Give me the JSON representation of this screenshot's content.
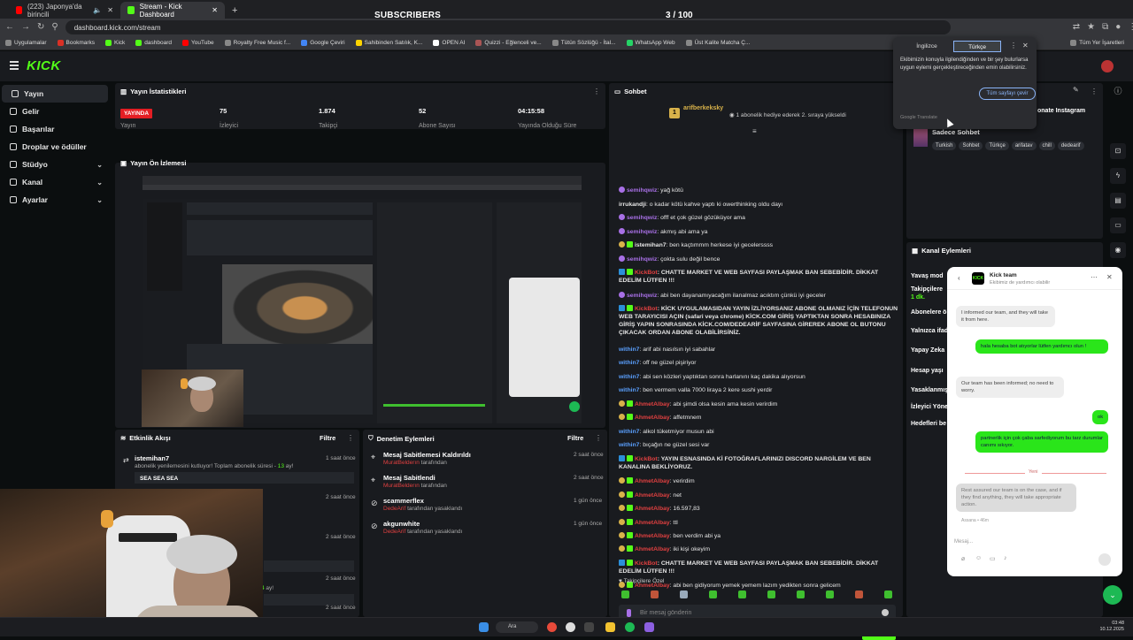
{
  "browser": {
    "tabs": [
      {
        "label": "(223) Japonya'da birincili",
        "active": false
      },
      {
        "label": "Stream - Kick Dashboard",
        "active": true
      }
    ],
    "new_tab": "+",
    "url": "dashboard.kick.com/stream",
    "bookmarks": [
      "Uygulamalar",
      "Bookmarks",
      "Kick",
      "dashboard",
      "YouTube",
      "Royalty Free Music f...",
      "Google Çeviri",
      "Sahibinden Satılık, K...",
      "OPEN AI",
      "Quizzi - Eğlenceli ve...",
      "Tütün Sözlüğü - İtal...",
      "WhatsApp Web",
      "Üst Kalite Matcha Ç..."
    ],
    "all_bookmarks": "Tüm Yer İşaretleri"
  },
  "overlay": {
    "title": "SUBSCRIBERS",
    "count": "3  / 100",
    "progress": 0.03
  },
  "sidebar": {
    "items": [
      {
        "label": "Yayın",
        "active": true,
        "chevron": false
      },
      {
        "label": "Gelir",
        "active": false,
        "chevron": false
      },
      {
        "label": "Başarılar",
        "active": false,
        "chevron": false
      },
      {
        "label": "Droplar ve ödüller",
        "active": false,
        "chevron": false
      },
      {
        "label": "Stüdyo",
        "active": false,
        "chevron": true
      },
      {
        "label": "Kanal",
        "active": false,
        "chevron": true
      },
      {
        "label": "Ayarlar",
        "active": false,
        "chevron": true
      }
    ]
  },
  "stats": {
    "title": "Yayın İstatistikleri",
    "live_badge": "YAYINDA",
    "items": [
      {
        "label": "Yayın",
        "value": ""
      },
      {
        "label": "İzleyici",
        "value": "75"
      },
      {
        "label": "Takipçi",
        "value": "1.874"
      },
      {
        "label": "Abone Sayısı",
        "value": "52"
      },
      {
        "label": "Yayında Olduğu Süre",
        "value": "04:15:58"
      }
    ]
  },
  "preview": {
    "title": "Yayın Ön İzlemesi"
  },
  "activity": {
    "title": "Etkinlik Akışı",
    "filter": "Filtre",
    "events": [
      {
        "user": "istemihan7",
        "desc": "abonelik yenilemesini kutluyor! Toplam abonelik süresi - ",
        "highlight": "13",
        "suffix": " ay!",
        "time": "1 saat önce",
        "message": "SEA SEA SEA"
      },
      {
        "time": "2 saat önce"
      },
      {
        "time": "2 saat önce"
      },
      {
        "time": "2 saat önce"
      },
      {
        "desc": "Toplam abonelik süresi - ",
        "highlight": "4",
        "suffix": " ay!",
        "time": "2 saat önce"
      },
      {
        "time": "2 saat önce"
      }
    ]
  },
  "moderation": {
    "title": "Denetim Eylemleri",
    "filter": "Filtre",
    "events": [
      {
        "title": "Mesaj Sabitlemesi Kaldırıldı",
        "by": "MuratBelderın",
        "suffix": " tarafından",
        "time": "2 saat önce"
      },
      {
        "title": "Mesaj Sabitlendi",
        "by": "MuratBelderın",
        "suffix": " tarafından",
        "time": "2 saat önce"
      },
      {
        "title": "scammerflex",
        "by": "DedeArif",
        "suffix": " tarafından yasaklandı",
        "time": "1 gün önce"
      },
      {
        "title": "akgunwhite",
        "by": "DedeArif",
        "suffix": " tarafından yasaklandı",
        "time": "1 gün önce"
      }
    ]
  },
  "chat": {
    "title": "Sohbet",
    "gift_user": "arifberkeksky",
    "gift_text": "1 abonelik hediye ederek 2. sıraya yükseldi",
    "messages": [
      {
        "user": "semihqwiz",
        "color": "#a870e6",
        "badge": "pu",
        "text": ": yağ kötü"
      },
      {
        "user": "irrukandji",
        "color": "#e6e6e6",
        "badge": "",
        "text": ": o kadar kötü kahve yaptı ki owerthinking oldu dayı"
      },
      {
        "user": "semihqwiz",
        "color": "#a870e6",
        "badge": "pu",
        "text": ": offf et çok güzel gözüküyor ama"
      },
      {
        "user": "semihqwiz",
        "color": "#a870e6",
        "badge": "pu",
        "text": ": akmış abi ama ya"
      },
      {
        "user": "istemihan7",
        "color": "#e6e6e6",
        "badge": "gold",
        "text": ": ben kaçtımmm herkese iyi gecelerssss"
      },
      {
        "user": "semihqwiz",
        "color": "#a870e6",
        "badge": "pu",
        "text": ": çokta sulu değil bence"
      },
      {
        "user": "KickBot",
        "color": "#e04040",
        "badge": "sq",
        "text": ": CHATTE MARKET VE WEB SAYFASI PAYLAŞMAK BAN SEBEBİDİR. DİKKAT EDELİM LÜTFEN !!!"
      },
      {
        "user": "semihqwiz",
        "color": "#a870e6",
        "badge": "pu",
        "text": ": abi ben dayanamıyacağım ilanalmaz acıktım çünkü iyi geceler"
      },
      {
        "user": "KickBot",
        "color": "#e04040",
        "badge": "sq",
        "text": ": KİCK UYGULAMASIDAN YAYIN İZLİYORSANIZ ABONE OLMANIZ İÇİN TELEFONUN WEB TARAYICISI AÇIN (safari veya chrome) KİCK.COM GİRİŞ YAPTIKTAN SONRA HESABINIZA GİRİŞ YAPIN SONRASINDA KİCK.COM/DEDEARİF SAYFASINA GİREREK ABONE OL BUTONU ÇIKACAK ORDAN ABONE OLABİLİRSİNİZ."
      },
      {
        "user": "within7",
        "color": "#5aa0ff",
        "badge": "",
        "text": ": arif abi nasılsın iyi sabahlar"
      },
      {
        "user": "within7",
        "color": "#5aa0ff",
        "badge": "",
        "text": ": off ne güzel pişiriyor"
      },
      {
        "user": "within7",
        "color": "#5aa0ff",
        "badge": "",
        "text": ": abi sen közleri yaptıktan sonra harlanını kaç dakika alıyorsun"
      },
      {
        "user": "within7",
        "color": "#5aa0ff",
        "badge": "",
        "text": ": ben vermem valla 7000 liraya 2 kere sushi yerdir"
      },
      {
        "user": "AhmetAlbay",
        "color": "#e04040",
        "badge": "gold",
        "text": ": abi şimdi olsa kesin ama kesin verirdim"
      },
      {
        "user": "AhmetAlbay",
        "color": "#e04040",
        "badge": "gold",
        "text": ": affetmnem"
      },
      {
        "user": "within7",
        "color": "#5aa0ff",
        "badge": "",
        "text": ": alkol tüketmiyor musun abi"
      },
      {
        "user": "within7",
        "color": "#5aa0ff",
        "badge": "",
        "text": ": bıçağın ne güzel sesi var"
      },
      {
        "user": "KickBot",
        "color": "#e04040",
        "badge": "sq",
        "text": ": YAYIN ESNASINDA Kİ FOTOĞRAFLARINIZI DISCORD NARGİLEM VE BEN KANALINA BEKLİYORUZ."
      },
      {
        "user": "AhmetAlbay",
        "color": "#e04040",
        "badge": "gold",
        "text": ": verirdim"
      },
      {
        "user": "AhmetAlbay",
        "color": "#e04040",
        "badge": "gold",
        "text": ": net"
      },
      {
        "user": "AhmetAlbay",
        "color": "#e04040",
        "badge": "gold",
        "text": ": 16.597,83"
      },
      {
        "user": "AhmetAlbay",
        "color": "#e04040",
        "badge": "gold",
        "text": ": ttl"
      },
      {
        "user": "AhmetAlbay",
        "color": "#e04040",
        "badge": "gold",
        "text": ": ben verdim abi ya"
      },
      {
        "user": "AhmetAlbay",
        "color": "#e04040",
        "badge": "gold",
        "text": ": iki kişi okeyim"
      },
      {
        "user": "KickBot",
        "color": "#e04040",
        "badge": "sq",
        "text": ": CHATTE MARKET VE WEB SAYFASI PAYLAŞMAK BAN SEBEBİDİR. DİKKAT EDELİM LÜTFEN !!!"
      },
      {
        "user": "AhmetAlbay",
        "color": "#e04040",
        "badge": "gold",
        "text": ": abi ben gidiyorum yemek yemem lazım yedikten sonra gelicem"
      }
    ],
    "followers_only": "Takipçilere Özel",
    "input_placeholder": "Bir mesaj gönderin",
    "send": "Gönder",
    "count_a": "0",
    "count_b": "0"
  },
  "stream_info": {
    "title_partial": "onate Instagram",
    "category": "Sadece Sohbet",
    "tags": [
      "Turkish",
      "Sohbet",
      "Türkçe",
      "arifatav",
      "chill",
      "dedearif"
    ]
  },
  "channel_actions": {
    "title": "Kanal Eylemleri",
    "items": [
      "Yavaş mod",
      "Takipçilere",
      "1 dk.",
      "Abonelere ö",
      "Yalnızca ifad",
      "Yapay Zeka",
      "Hesap yaşı",
      "Yasaklanmış",
      "İzleyici Yöne",
      "Hedefleri be"
    ]
  },
  "translate": {
    "lang_a": "İngilizce",
    "lang_b": "Türkçe",
    "text": "Ekibimizin konuyla ilgilendiğinden ve bir şey bulurlarsa uygun eylemi gerçekleştireceğinden emin olabilirsiniz.",
    "button": "Tüm sayfayı çevir",
    "footer": "Google Translate"
  },
  "support": {
    "name": "Kick team",
    "subtitle": "Ekibimiz de yardımcı olabilir",
    "logo": "KICK",
    "messages": [
      {
        "side": "in",
        "text": "I informed our team, and they will take it from here."
      },
      {
        "side": "out",
        "text": "hala hesaba bot atıyorlar lütfen yardımcı olun !"
      },
      {
        "side": "in",
        "text": "Our team has been informed; no need to worry."
      },
      {
        "side": "out",
        "text": "ok"
      },
      {
        "side": "out",
        "text": "partnerlik için çok çaba sarfediyorum bu tarz durumlar canımı sıkıyor."
      },
      {
        "side": "sel",
        "text": "Rest assured our team is on the case, and if they find anything, they will take appropriate action."
      }
    ],
    "new_divider": "Yeni",
    "meta": "Assana • 46m",
    "input_placeholder": "Mesaj..."
  },
  "taskbar": {
    "search": "Ara",
    "time": "03:48",
    "date": "10.12.2025"
  },
  "colors": {
    "kick_green": "#53fc18",
    "live_red": "#e31e24",
    "panel": "#191b1f",
    "bg": "#0b0e0f"
  }
}
